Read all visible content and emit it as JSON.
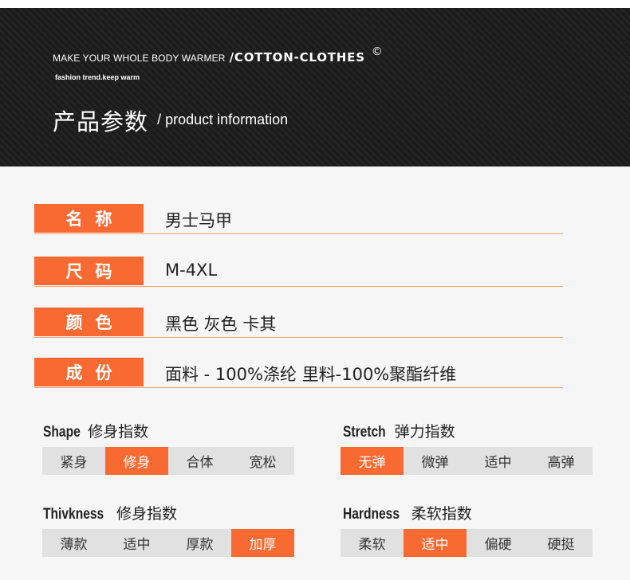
{
  "header": {
    "tagline": "MAKE YOUR WHOLE BODY WARMER",
    "brand": "/COTTON-CLOTHES",
    "copyright": "©",
    "subline": "fashion trend.keep warm",
    "title_cn": "产品参数",
    "title_en": "/ product information"
  },
  "specs": [
    {
      "label": "名称",
      "value": "男士马甲"
    },
    {
      "label": "尺码",
      "value": "M-4XL"
    },
    {
      "label": "颜色",
      "value": "黑色 灰色 卡其"
    },
    {
      "label": "成份",
      "value": "面料 - 100%涤纶  里料-100%聚酯纤维"
    }
  ],
  "indices": [
    {
      "en": "Shape",
      "cn": "修身指数",
      "options": [
        "紧身",
        "修身",
        "合体",
        "宽松"
      ],
      "selected": 1
    },
    {
      "en": "Stretch",
      "cn": "弹力指数",
      "options": [
        "无弹",
        "微弹",
        "适中",
        "高弹"
      ],
      "selected": 0
    },
    {
      "en": "Thivkness",
      "cn": "修身指数",
      "options": [
        "薄款",
        "适中",
        "厚款",
        "加厚"
      ],
      "selected": 3
    },
    {
      "en": "Hardness",
      "cn": "柔软指数",
      "options": [
        "柔软",
        "适中",
        "偏硬",
        "硬挺"
      ],
      "selected": 1
    }
  ],
  "colors": {
    "accent": "#f86a32",
    "header_bg": "#1c1c1c",
    "scale_bg": "#e1e1e1"
  }
}
